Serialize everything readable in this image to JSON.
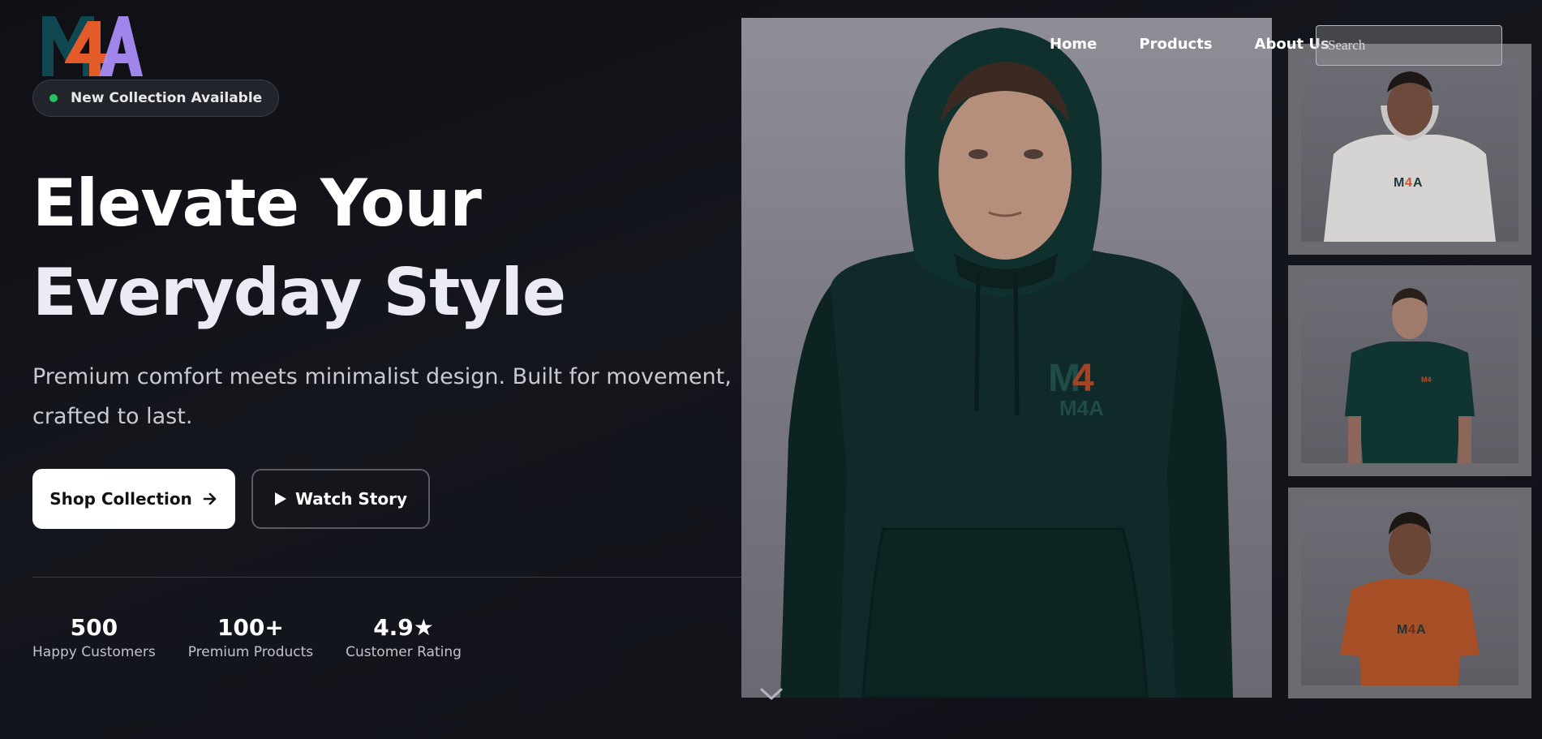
{
  "brand": {
    "logo_text": "M4A",
    "colors": {
      "m": "#0f4850",
      "four": "#e35b28",
      "a": "#a98df5"
    }
  },
  "badge": {
    "label": "New Collection Available",
    "dot_color": "#22c55e"
  },
  "hero": {
    "title_line1": "Elevate Your",
    "title_line2": "Everyday Style",
    "subtitle": "Premium comfort meets minimalist design. Built for movement, crafted to last."
  },
  "cta": {
    "primary_label": "Shop Collection",
    "primary_icon": "arrow-right-icon",
    "secondary_label": "Watch Story",
    "secondary_icon": "play-icon"
  },
  "stats": [
    {
      "value": "500",
      "label": "Happy Customers"
    },
    {
      "value": "100+",
      "label": "Premium Products"
    },
    {
      "value": "4.9★",
      "label": "Customer Rating"
    }
  ],
  "nav": {
    "items": [
      "Home",
      "Products",
      "About Us"
    ],
    "search_placeholder": "Search"
  },
  "products": {
    "main_image": {
      "description": "dark green hoodie",
      "garment_color": "#0f2a29"
    },
    "thumbnails": [
      {
        "garment": "hoodie",
        "color": "#d6d4d2"
      },
      {
        "garment": "t-shirt",
        "color": "#0f3432"
      },
      {
        "garment": "t-shirt",
        "color": "#a64e26"
      }
    ]
  },
  "scroll_icon": "chevron-down-icon"
}
